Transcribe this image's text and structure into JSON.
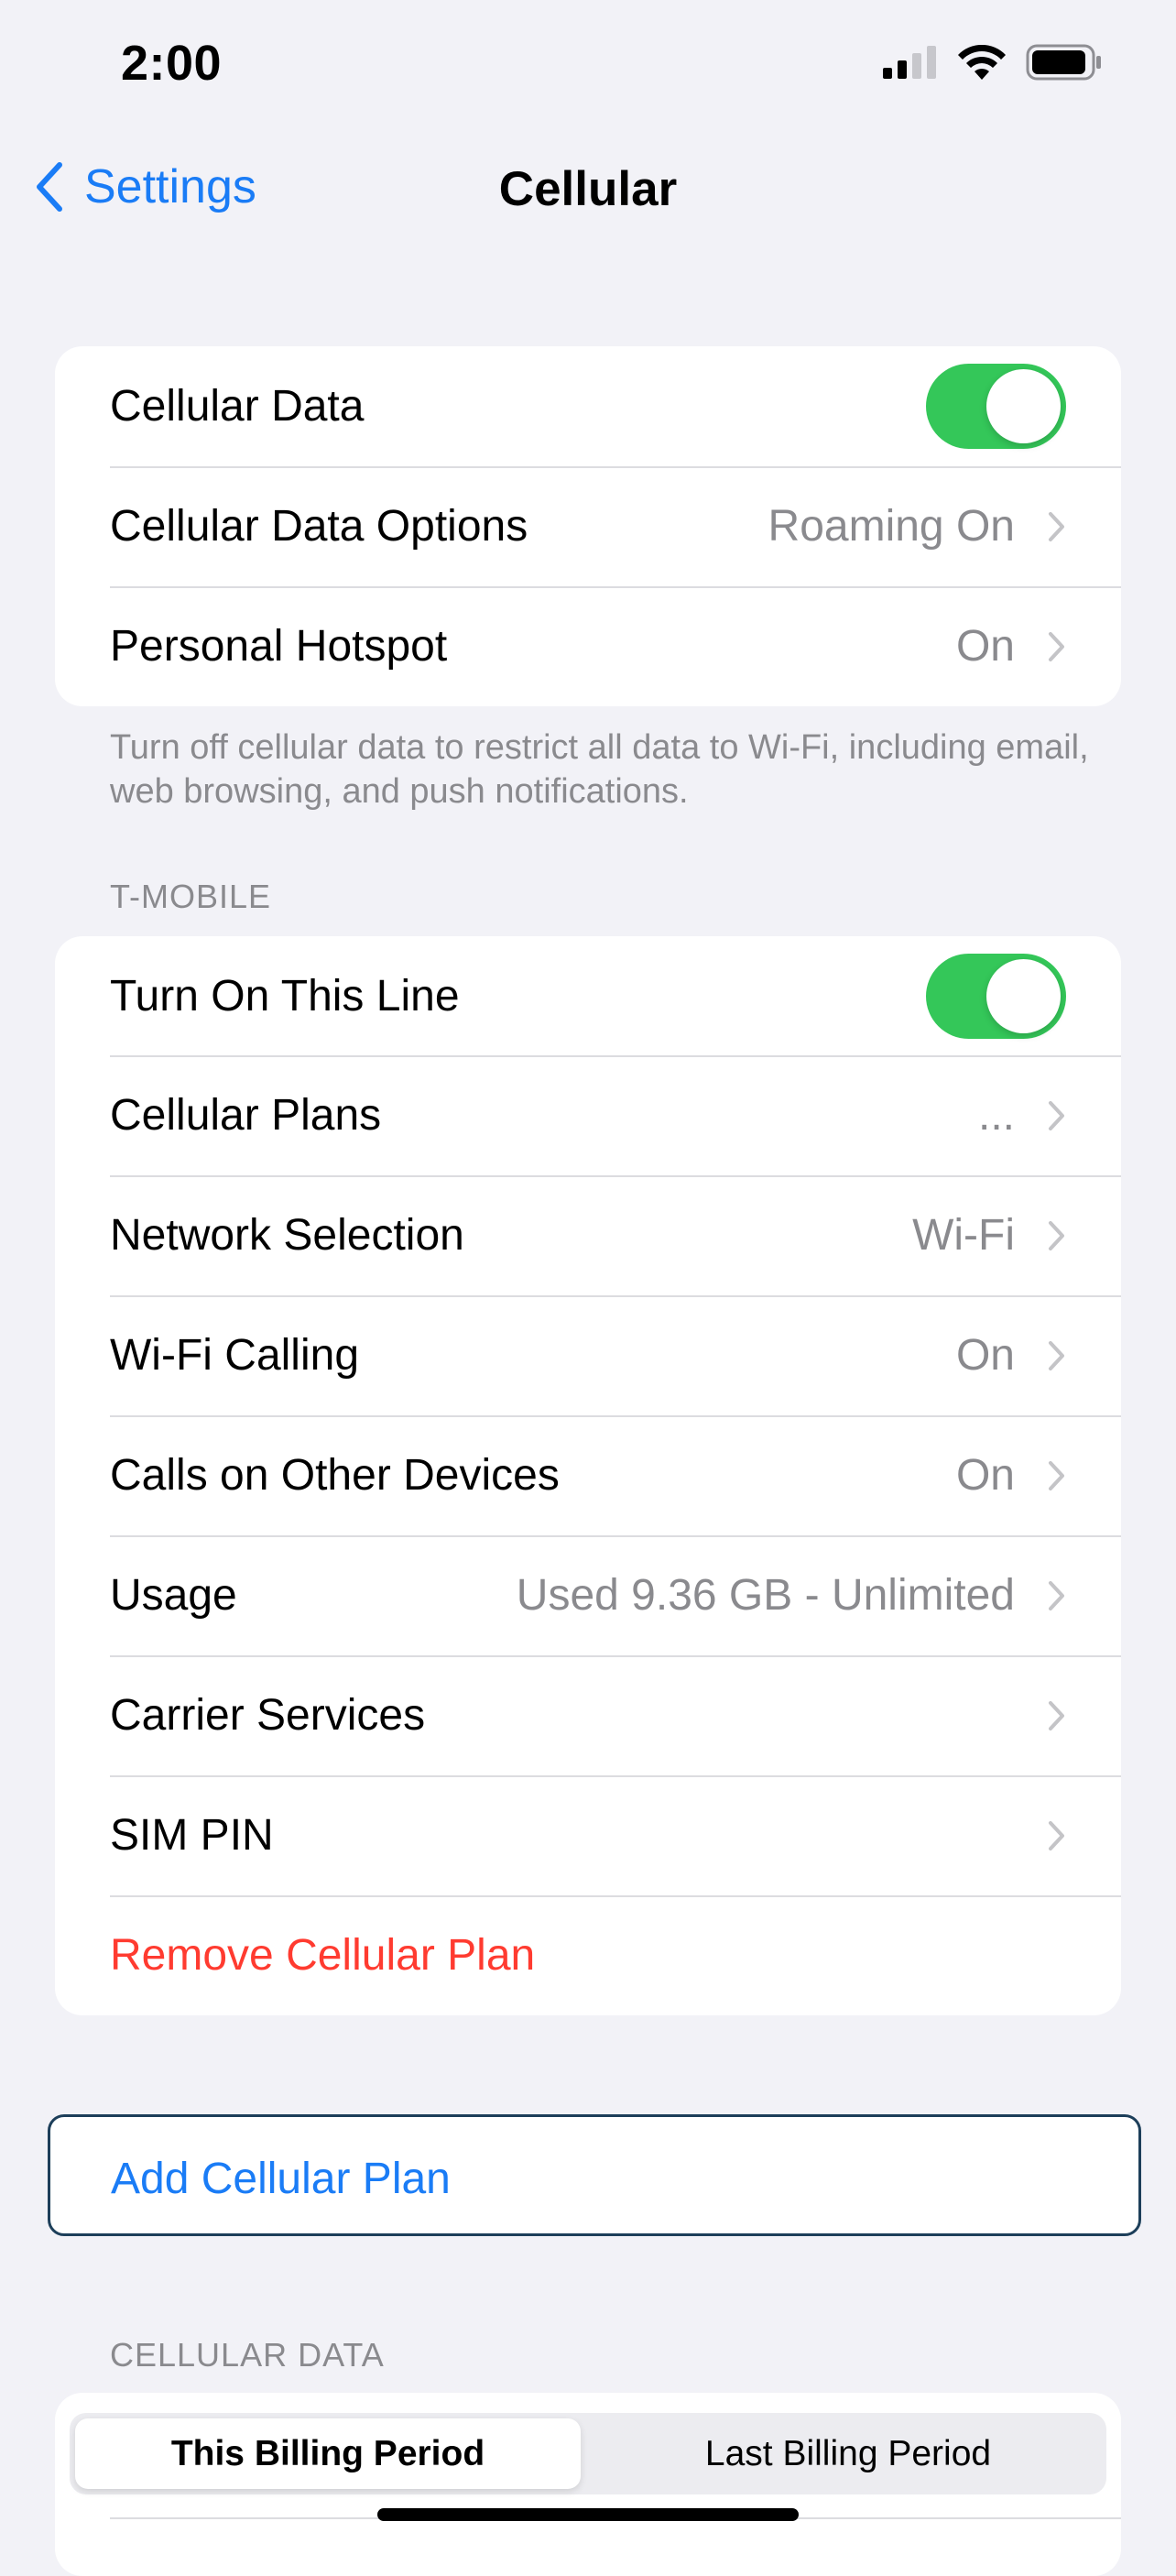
{
  "status_bar": {
    "time": "2:00",
    "icons": [
      "cellular-signal-icon",
      "wifi-icon",
      "battery-icon"
    ]
  },
  "nav": {
    "back_label": "Settings",
    "title": "Cellular"
  },
  "group1": {
    "rows": [
      {
        "label": "Cellular Data",
        "toggle": true
      },
      {
        "label": "Cellular Data Options",
        "value": "Roaming On"
      },
      {
        "label": "Personal Hotspot",
        "value": "On"
      }
    ],
    "footer": "Turn off cellular data to restrict all data to Wi-Fi, including email, web browsing, and push notifications."
  },
  "tmobile": {
    "header": "T-MOBILE",
    "rows": [
      {
        "label": "Turn On This Line",
        "toggle": true
      },
      {
        "label": "Cellular Plans",
        "value": "..."
      },
      {
        "label": "Network Selection",
        "value": "Wi-Fi"
      },
      {
        "label": "Wi-Fi Calling",
        "value": "On"
      },
      {
        "label": "Calls on Other Devices",
        "value": "On"
      },
      {
        "label": "Usage",
        "value": "Used 9.36 GB - Unlimited"
      },
      {
        "label": "Carrier Services"
      },
      {
        "label": "SIM PIN"
      },
      {
        "label": "Remove Cellular Plan"
      }
    ]
  },
  "add_plan": {
    "label": "Add Cellular Plan"
  },
  "cellular_data": {
    "header": "CELLULAR DATA",
    "segments": [
      "This Billing Period",
      "Last Billing Period"
    ],
    "selected": "This Billing Period"
  },
  "colors": {
    "accent": "#1a7cf6",
    "toggle_on": "#34c759",
    "destructive": "#ff3b30",
    "background": "#f2f2f7",
    "secondary_text": "#8a8a8e"
  }
}
